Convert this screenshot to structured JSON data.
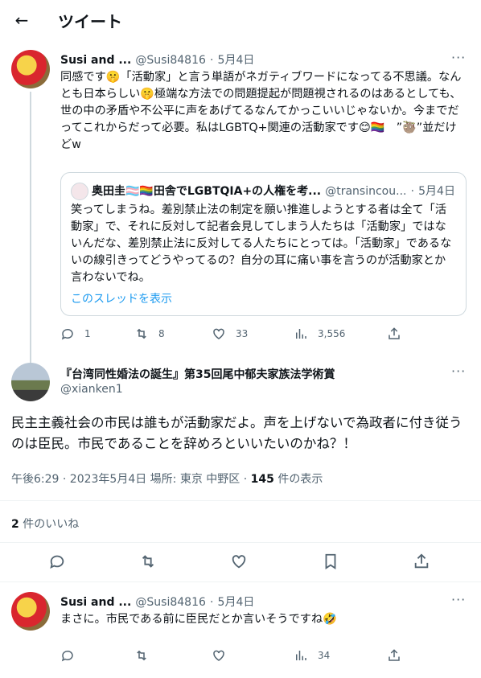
{
  "header": {
    "back_icon": "arrow-left-icon",
    "title": "ツイート"
  },
  "tweet1": {
    "name": "Susi and ...",
    "handle": "@Susi84816",
    "sep": "·",
    "date": "5月4日",
    "text": "同感です🤫「活動家」と言う単語がネガティブワードになってる不思議。なんとも日本らしい🤫極端な方法での問題提起が問題視されるのはあるとしても、世の中の矛盾や不公平に声をあげてるなんてかっこいいじゃないか。今までだってこれからだって必要。私はLGBTQ+関連の活動家です😊🏳️‍🌈　”🦥”並だけどw",
    "quote": {
      "name": "奥田圭🏳️‍⚧️🏳️‍🌈田舎でLGBTQIA+の人権を考...",
      "handle": "@transincou...",
      "sep": "·",
      "date": "5月4日",
      "text": "笑ってしまうね。差別禁止法の制定を願い推進しようとする者は全て「活動家」で、それに反対して記者会見してしまう人たちは「活動家」ではないんだな、差別禁止法に反対してる人たちにとっては。「活動家」であるないの線引きってどうやってるの？自分の耳に痛い事を言うのが活動家とか言わないでね。",
      "show_thread": "このスレッドを表示"
    },
    "actions": {
      "reply": "1",
      "retweet": "8",
      "like": "33",
      "views": "3,556"
    }
  },
  "tweet2": {
    "name": "『台湾同性婚法の誕生』第35回尾中郁夫家族法学術賞",
    "handle": "@xianken1",
    "text": "民主主義社会の市民は誰もが活動家だよ。声を上げないで為政者に付き従うのは臣民。市民であることを辞めろといいたいのかね？！",
    "time": "午後6:29 · 2023年5月4日 場所: 東京 中野区 ·",
    "views_count": "145",
    "views_label": " 件の表示",
    "likes_count": "2",
    "likes_label": " 件のいいね"
  },
  "tweet3": {
    "name": "Susi and ...",
    "handle": "@Susi84816",
    "sep": "·",
    "date": "5月4日",
    "text": "まさに。市民である前に臣民だとか言いそうですね🤣",
    "actions": {
      "views": "34"
    }
  },
  "colors": {
    "accent": "#1d9bf0",
    "muted": "#536471",
    "border": "#cfd9de"
  }
}
